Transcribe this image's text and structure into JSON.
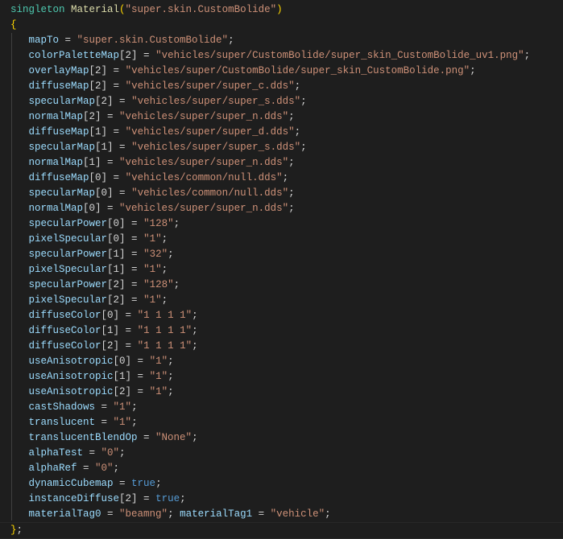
{
  "editor": {
    "lines": [
      {
        "tokens": [
          {
            "text": "singleton ",
            "kind": "keyword"
          },
          {
            "text": "Material",
            "kind": "function"
          },
          {
            "text": "(",
            "kind": "bracket"
          },
          {
            "text": "\"super.skin.CustomBolide\"",
            "kind": "string"
          },
          {
            "text": ")",
            "kind": "bracket"
          }
        ]
      },
      {
        "tokens": [
          {
            "text": "{",
            "kind": "bracket"
          }
        ]
      },
      {
        "tokens": [
          {
            "text": "   mapTo",
            "kind": "variable"
          },
          {
            "text": " = ",
            "kind": "punct"
          },
          {
            "text": "\"super.skin.CustomBolide\"",
            "kind": "string"
          },
          {
            "text": ";",
            "kind": "punct"
          }
        ]
      },
      {
        "tokens": [
          {
            "text": "   colorPaletteMap",
            "kind": "variable"
          },
          {
            "text": "[2]",
            "kind": "index"
          },
          {
            "text": " = ",
            "kind": "punct"
          },
          {
            "text": "\"vehicles/super/CustomBolide/super_skin_CustomBolide_uv1.png\"",
            "kind": "string"
          },
          {
            "text": ";",
            "kind": "punct"
          }
        ]
      },
      {
        "tokens": [
          {
            "text": "   overlayMap",
            "kind": "variable"
          },
          {
            "text": "[2]",
            "kind": "index"
          },
          {
            "text": " = ",
            "kind": "punct"
          },
          {
            "text": "\"vehicles/super/CustomBolide/super_skin_CustomBolide.png\"",
            "kind": "string"
          },
          {
            "text": ";",
            "kind": "punct"
          }
        ]
      },
      {
        "tokens": [
          {
            "text": "   diffuseMap",
            "kind": "variable"
          },
          {
            "text": "[2]",
            "kind": "index"
          },
          {
            "text": " = ",
            "kind": "punct"
          },
          {
            "text": "\"vehicles/super/super_c.dds\"",
            "kind": "string"
          },
          {
            "text": ";",
            "kind": "punct"
          }
        ]
      },
      {
        "tokens": [
          {
            "text": "   specularMap",
            "kind": "variable"
          },
          {
            "text": "[2]",
            "kind": "index"
          },
          {
            "text": " = ",
            "kind": "punct"
          },
          {
            "text": "\"vehicles/super/super_s.dds\"",
            "kind": "string"
          },
          {
            "text": ";",
            "kind": "punct"
          }
        ]
      },
      {
        "tokens": [
          {
            "text": "   normalMap",
            "kind": "variable"
          },
          {
            "text": "[2]",
            "kind": "index"
          },
          {
            "text": " = ",
            "kind": "punct"
          },
          {
            "text": "\"vehicles/super/super_n.dds\"",
            "kind": "string"
          },
          {
            "text": ";",
            "kind": "punct"
          }
        ]
      },
      {
        "tokens": [
          {
            "text": "   diffuseMap",
            "kind": "variable"
          },
          {
            "text": "[1]",
            "kind": "index"
          },
          {
            "text": " = ",
            "kind": "punct"
          },
          {
            "text": "\"vehicles/super/super_d.dds\"",
            "kind": "string"
          },
          {
            "text": ";",
            "kind": "punct"
          }
        ]
      },
      {
        "tokens": [
          {
            "text": "   specularMap",
            "kind": "variable"
          },
          {
            "text": "[1]",
            "kind": "index"
          },
          {
            "text": " = ",
            "kind": "punct"
          },
          {
            "text": "\"vehicles/super/super_s.dds\"",
            "kind": "string"
          },
          {
            "text": ";",
            "kind": "punct"
          }
        ]
      },
      {
        "tokens": [
          {
            "text": "   normalMap",
            "kind": "variable"
          },
          {
            "text": "[1]",
            "kind": "index"
          },
          {
            "text": " = ",
            "kind": "punct"
          },
          {
            "text": "\"vehicles/super/super_n.dds\"",
            "kind": "string"
          },
          {
            "text": ";",
            "kind": "punct"
          }
        ]
      },
      {
        "tokens": [
          {
            "text": "   diffuseMap",
            "kind": "variable"
          },
          {
            "text": "[0]",
            "kind": "index"
          },
          {
            "text": " = ",
            "kind": "punct"
          },
          {
            "text": "\"vehicles/common/null.dds\"",
            "kind": "string"
          },
          {
            "text": ";",
            "kind": "punct"
          }
        ]
      },
      {
        "tokens": [
          {
            "text": "   specularMap",
            "kind": "variable"
          },
          {
            "text": "[0]",
            "kind": "index"
          },
          {
            "text": " = ",
            "kind": "punct"
          },
          {
            "text": "\"vehicles/common/null.dds\"",
            "kind": "string"
          },
          {
            "text": ";",
            "kind": "punct"
          }
        ]
      },
      {
        "tokens": [
          {
            "text": "   normalMap",
            "kind": "variable"
          },
          {
            "text": "[0]",
            "kind": "index"
          },
          {
            "text": " = ",
            "kind": "punct"
          },
          {
            "text": "\"vehicles/super/super_n.dds\"",
            "kind": "string"
          },
          {
            "text": ";",
            "kind": "punct"
          }
        ]
      },
      {
        "tokens": [
          {
            "text": "   specularPower",
            "kind": "variable"
          },
          {
            "text": "[0]",
            "kind": "index"
          },
          {
            "text": " = ",
            "kind": "punct"
          },
          {
            "text": "\"128\"",
            "kind": "string"
          },
          {
            "text": ";",
            "kind": "punct"
          }
        ]
      },
      {
        "tokens": [
          {
            "text": "   pixelSpecular",
            "kind": "variable"
          },
          {
            "text": "[0]",
            "kind": "index"
          },
          {
            "text": " = ",
            "kind": "punct"
          },
          {
            "text": "\"1\"",
            "kind": "string"
          },
          {
            "text": ";",
            "kind": "punct"
          }
        ]
      },
      {
        "tokens": [
          {
            "text": "   specularPower",
            "kind": "variable"
          },
          {
            "text": "[1]",
            "kind": "index"
          },
          {
            "text": " = ",
            "kind": "punct"
          },
          {
            "text": "\"32\"",
            "kind": "string"
          },
          {
            "text": ";",
            "kind": "punct"
          }
        ]
      },
      {
        "tokens": [
          {
            "text": "   pixelSpecular",
            "kind": "variable"
          },
          {
            "text": "[1]",
            "kind": "index"
          },
          {
            "text": " = ",
            "kind": "punct"
          },
          {
            "text": "\"1\"",
            "kind": "string"
          },
          {
            "text": ";",
            "kind": "punct"
          }
        ]
      },
      {
        "tokens": [
          {
            "text": "   specularPower",
            "kind": "variable"
          },
          {
            "text": "[2]",
            "kind": "index"
          },
          {
            "text": " = ",
            "kind": "punct"
          },
          {
            "text": "\"128\"",
            "kind": "string"
          },
          {
            "text": ";",
            "kind": "punct"
          }
        ]
      },
      {
        "tokens": [
          {
            "text": "   pixelSpecular",
            "kind": "variable"
          },
          {
            "text": "[2]",
            "kind": "index"
          },
          {
            "text": " = ",
            "kind": "punct"
          },
          {
            "text": "\"1\"",
            "kind": "string"
          },
          {
            "text": ";",
            "kind": "punct"
          }
        ]
      },
      {
        "tokens": [
          {
            "text": "   diffuseColor",
            "kind": "variable"
          },
          {
            "text": "[0]",
            "kind": "index"
          },
          {
            "text": " = ",
            "kind": "punct"
          },
          {
            "text": "\"1 1 1 1\"",
            "kind": "string"
          },
          {
            "text": ";",
            "kind": "punct"
          }
        ]
      },
      {
        "tokens": [
          {
            "text": "   diffuseColor",
            "kind": "variable"
          },
          {
            "text": "[1]",
            "kind": "index"
          },
          {
            "text": " = ",
            "kind": "punct"
          },
          {
            "text": "\"1 1 1 1\"",
            "kind": "string"
          },
          {
            "text": ";",
            "kind": "punct"
          }
        ]
      },
      {
        "tokens": [
          {
            "text": "   diffuseColor",
            "kind": "variable"
          },
          {
            "text": "[2]",
            "kind": "index"
          },
          {
            "text": " = ",
            "kind": "punct"
          },
          {
            "text": "\"1 1 1 1\"",
            "kind": "string"
          },
          {
            "text": ";",
            "kind": "punct"
          }
        ]
      },
      {
        "tokens": [
          {
            "text": "   useAnisotropic",
            "kind": "variable"
          },
          {
            "text": "[0]",
            "kind": "index"
          },
          {
            "text": " = ",
            "kind": "punct"
          },
          {
            "text": "\"1\"",
            "kind": "string"
          },
          {
            "text": ";",
            "kind": "punct"
          }
        ]
      },
      {
        "tokens": [
          {
            "text": "   useAnisotropic",
            "kind": "variable"
          },
          {
            "text": "[1]",
            "kind": "index"
          },
          {
            "text": " = ",
            "kind": "punct"
          },
          {
            "text": "\"1\"",
            "kind": "string"
          },
          {
            "text": ";",
            "kind": "punct"
          }
        ]
      },
      {
        "tokens": [
          {
            "text": "   useAnisotropic",
            "kind": "variable"
          },
          {
            "text": "[2]",
            "kind": "index"
          },
          {
            "text": " = ",
            "kind": "punct"
          },
          {
            "text": "\"1\"",
            "kind": "string"
          },
          {
            "text": ";",
            "kind": "punct"
          }
        ]
      },
      {
        "tokens": [
          {
            "text": "   castShadows",
            "kind": "variable"
          },
          {
            "text": " = ",
            "kind": "punct"
          },
          {
            "text": "\"1\"",
            "kind": "string"
          },
          {
            "text": ";",
            "kind": "punct"
          }
        ]
      },
      {
        "tokens": [
          {
            "text": "   translucent",
            "kind": "variable"
          },
          {
            "text": " = ",
            "kind": "punct"
          },
          {
            "text": "\"1\"",
            "kind": "string"
          },
          {
            "text": ";",
            "kind": "punct"
          }
        ]
      },
      {
        "tokens": [
          {
            "text": "   translucentBlendOp",
            "kind": "variable"
          },
          {
            "text": " = ",
            "kind": "punct"
          },
          {
            "text": "\"None\"",
            "kind": "string"
          },
          {
            "text": ";",
            "kind": "punct"
          }
        ]
      },
      {
        "tokens": [
          {
            "text": "   alphaTest",
            "kind": "variable"
          },
          {
            "text": " = ",
            "kind": "punct"
          },
          {
            "text": "\"0\"",
            "kind": "string"
          },
          {
            "text": ";",
            "kind": "punct"
          }
        ]
      },
      {
        "tokens": [
          {
            "text": "   alphaRef",
            "kind": "variable"
          },
          {
            "text": " = ",
            "kind": "punct"
          },
          {
            "text": "\"0\"",
            "kind": "string"
          },
          {
            "text": ";",
            "kind": "punct"
          }
        ]
      },
      {
        "tokens": [
          {
            "text": "   dynamicCubemap",
            "kind": "variable"
          },
          {
            "text": " = ",
            "kind": "punct"
          },
          {
            "text": "true",
            "kind": "bool"
          },
          {
            "text": ";",
            "kind": "punct"
          }
        ]
      },
      {
        "tokens": [
          {
            "text": "   instanceDiffuse",
            "kind": "variable"
          },
          {
            "text": "[2]",
            "kind": "index"
          },
          {
            "text": " = ",
            "kind": "punct"
          },
          {
            "text": "true",
            "kind": "bool"
          },
          {
            "text": ";",
            "kind": "punct"
          }
        ]
      },
      {
        "tokens": [
          {
            "text": "   materialTag0",
            "kind": "variable"
          },
          {
            "text": " = ",
            "kind": "punct"
          },
          {
            "text": "\"beamng\"",
            "kind": "string"
          },
          {
            "text": "; ",
            "kind": "punct"
          },
          {
            "text": "materialTag1",
            "kind": "variable"
          },
          {
            "text": " = ",
            "kind": "punct"
          },
          {
            "text": "\"vehicle\"",
            "kind": "string"
          },
          {
            "text": ";",
            "kind": "punct"
          }
        ]
      },
      {
        "tokens": [
          {
            "text": "}",
            "kind": "bracket"
          },
          {
            "text": ";",
            "kind": "punct"
          }
        ]
      }
    ]
  }
}
